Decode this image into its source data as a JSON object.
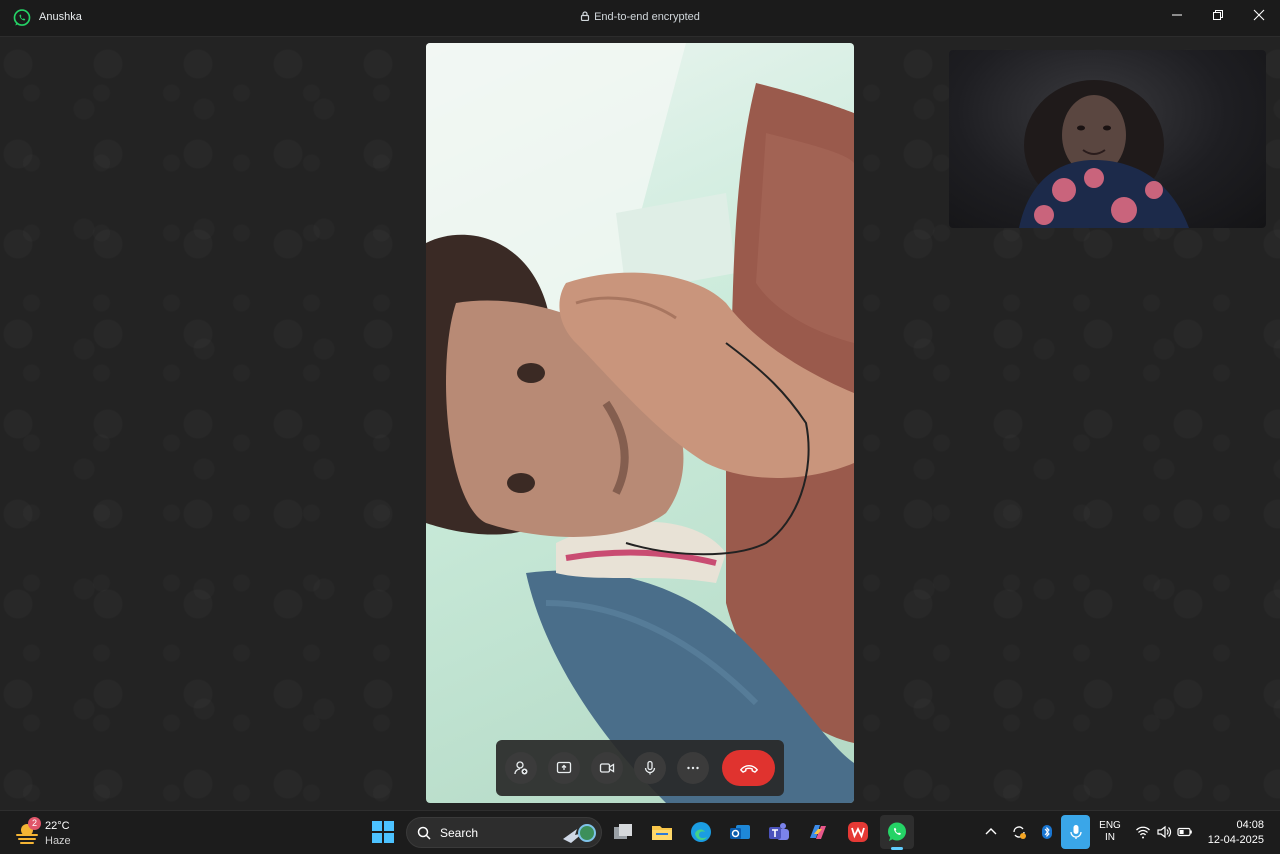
{
  "titlebar": {
    "contact_name": "Anushka",
    "encryption_label": "End-to-end encrypted",
    "icons": [
      "whatsapp-logo-icon",
      "lock-icon",
      "minimize-icon",
      "restore-icon",
      "close-icon"
    ]
  },
  "call": {
    "controls": [
      {
        "name": "add-participant",
        "icon": "add-person-icon"
      },
      {
        "name": "share-screen",
        "icon": "share-screen-icon"
      },
      {
        "name": "camera",
        "icon": "video-camera-icon"
      },
      {
        "name": "microphone",
        "icon": "microphone-icon"
      },
      {
        "name": "more-options",
        "icon": "more-dots-icon"
      },
      {
        "name": "end-call",
        "icon": "phone-hangup-icon"
      }
    ],
    "end_call_color": "#e0332f"
  },
  "taskbar": {
    "weather": {
      "badge": "2",
      "temperature": "22°C",
      "condition": "Haze"
    },
    "search_label": "Search",
    "pinned_apps": [
      "windows-start-icon",
      "task-view-icon",
      "file-explorer-icon",
      "edge-icon",
      "outlook-icon",
      "teams-icon",
      "copilot-icon",
      "wps-office-icon",
      "whatsapp-icon"
    ],
    "tray": {
      "language_line1": "ENG",
      "language_line2": "IN",
      "time": "04:08",
      "date": "12-04-2025"
    },
    "accent": "#60cdff"
  }
}
